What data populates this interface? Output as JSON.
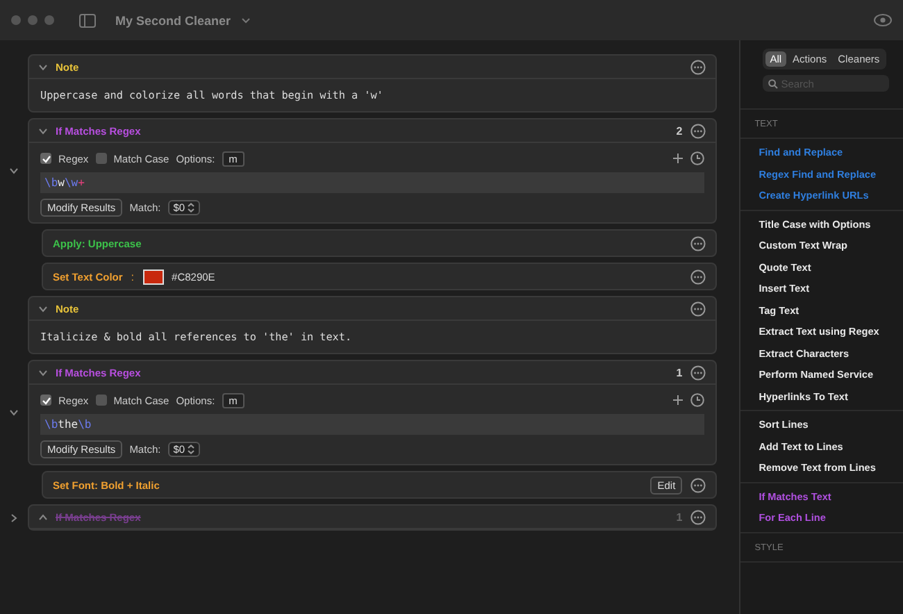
{
  "window": {
    "title": "My Second Cleaner"
  },
  "steps": [
    {
      "kind": "note",
      "label": "Note",
      "text": "Uppercase and colorize all words that begin with a 'w'"
    },
    {
      "kind": "regex",
      "label": "If Matches Regex",
      "count": "2",
      "expanded": true,
      "disabled": false,
      "regex_label": "Regex",
      "regex_checked": true,
      "case_label": "Match Case",
      "case_checked": false,
      "options_label": "Options:",
      "options": "m",
      "pattern": [
        {
          "text": "\\b",
          "kind": "escape"
        },
        {
          "text": "w",
          "kind": "literal"
        },
        {
          "text": "\\w",
          "kind": "escape"
        },
        {
          "text": "+",
          "kind": "quantifier"
        }
      ],
      "modify": "Modify Results",
      "match_label": "Match:",
      "match_value": "$0",
      "children": [
        {
          "kind": "apply",
          "label": "Apply: Uppercase"
        },
        {
          "kind": "textcolor",
          "label": "Set Text Color",
          "separator": ":",
          "color": "#c8290e",
          "value": "#C8290E"
        }
      ]
    },
    {
      "kind": "note",
      "label": "Note",
      "text": "Italicize & bold all references to 'the' in text."
    },
    {
      "kind": "regex",
      "label": "If Matches Regex",
      "count": "1",
      "expanded": true,
      "disabled": false,
      "regex_label": "Regex",
      "regex_checked": true,
      "case_label": "Match Case",
      "case_checked": false,
      "options_label": "Options:",
      "options": "m",
      "pattern": [
        {
          "text": "\\b",
          "kind": "escape"
        },
        {
          "text": "the",
          "kind": "literal"
        },
        {
          "text": "\\b",
          "kind": "escape"
        }
      ],
      "modify": "Modify Results",
      "match_label": "Match:",
      "match_value": "$0",
      "children": [
        {
          "kind": "font",
          "label": "Set Font: Bold + Italic",
          "button": "Edit"
        }
      ]
    },
    {
      "kind": "regex",
      "label": "If Matches Regex",
      "count": "1",
      "expanded": false,
      "disabled": true
    }
  ],
  "sidebar": {
    "filters": [
      {
        "label": "All",
        "selected": true
      },
      {
        "label": "Actions",
        "selected": false
      },
      {
        "label": "Cleaners",
        "selected": false
      }
    ],
    "search": {
      "placeholder": "Search"
    },
    "sections": [
      {
        "title": "TEXT",
        "groups": [
          [
            {
              "label": "Find and Replace",
              "kind": "regex"
            },
            {
              "label": "Regex Find and Replace",
              "kind": "regex"
            },
            {
              "label": "Create Hyperlink URLs",
              "kind": "regex"
            }
          ],
          [
            {
              "label": "Title Case with Options",
              "kind": "action"
            },
            {
              "label": "Custom Text Wrap",
              "kind": "action"
            },
            {
              "label": "Quote Text",
              "kind": "action"
            },
            {
              "label": "Insert Text",
              "kind": "action"
            },
            {
              "label": "Tag Text",
              "kind": "action"
            },
            {
              "label": "Extract Text using Regex",
              "kind": "action"
            },
            {
              "label": "Extract Characters",
              "kind": "action"
            },
            {
              "label": "Perform Named Service",
              "kind": "action"
            },
            {
              "label": "Hyperlinks To Text",
              "kind": "action"
            }
          ],
          [
            {
              "label": "Sort Lines",
              "kind": "action"
            },
            {
              "label": "Add Text to Lines",
              "kind": "action"
            },
            {
              "label": "Remove Text from Lines",
              "kind": "action"
            }
          ],
          [
            {
              "label": "If Matches Text",
              "kind": "control"
            },
            {
              "label": "For Each Line",
              "kind": "control"
            }
          ]
        ]
      },
      {
        "title": "STYLE"
      }
    ]
  }
}
